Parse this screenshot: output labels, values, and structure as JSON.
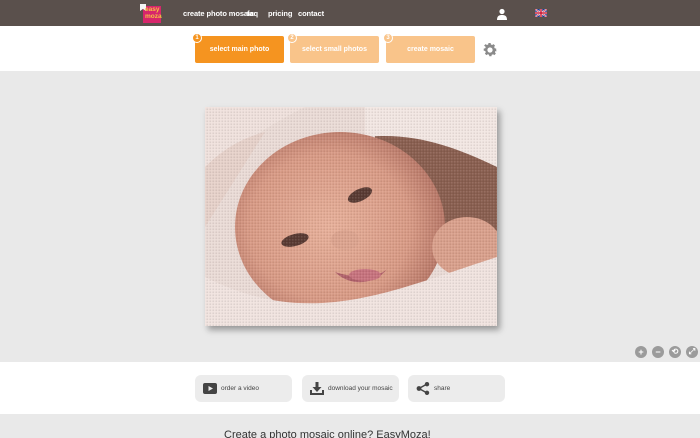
{
  "header": {
    "logo_text_line1": "easy",
    "logo_text_line2": "moza",
    "nav": [
      {
        "label": "create photo mosaic"
      },
      {
        "label": "faq"
      },
      {
        "label": "pricing"
      },
      {
        "label": "contact"
      }
    ],
    "user_icon": "user-icon",
    "language_flag": "uk-flag-icon"
  },
  "steps": [
    {
      "number": "1",
      "label": "select main photo",
      "state": "active"
    },
    {
      "number": "2",
      "label": "select small photos",
      "state": "inactive"
    },
    {
      "number": "3",
      "label": "create mosaic",
      "state": "inactive"
    }
  ],
  "settings_icon": "gear-icon",
  "canvas": {
    "image_description_icon": "mosaic-baby-photo",
    "zoom_controls": [
      {
        "symbol": "+",
        "icon": "zoom-in-icon"
      },
      {
        "symbol": "−",
        "icon": "zoom-out-icon"
      },
      {
        "symbol": "⟲",
        "icon": "rotate-icon"
      },
      {
        "symbol": "⤢",
        "icon": "fit-icon"
      }
    ]
  },
  "actions": [
    {
      "label": "order a video",
      "icon": "video-icon"
    },
    {
      "label": "download your mosaic",
      "icon": "download-icon"
    },
    {
      "label": "share",
      "icon": "share-icon"
    }
  ],
  "footer": {
    "heading": "Create a photo mosaic online? EasyMoza!"
  },
  "colors": {
    "nav_bg": "#5a504c",
    "step_active": "#f59420",
    "step_inactive": "#f9c48a",
    "logo_bg": "#d7266b",
    "canvas_bg": "#e9e9e9"
  }
}
